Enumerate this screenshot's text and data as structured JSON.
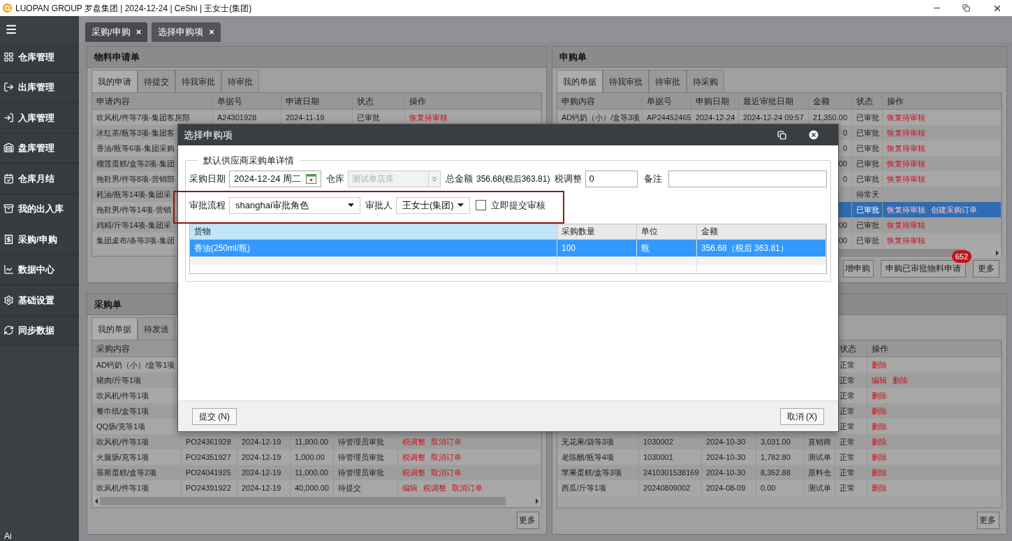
{
  "window": {
    "title": "LUOPAN GROUP 罗盘集团 | 2024-12-24 | CeShi | 王女士(集团)"
  },
  "sidebar": {
    "items": [
      {
        "label": "仓库管理"
      },
      {
        "label": "出库管理"
      },
      {
        "label": "入库管理"
      },
      {
        "label": "盘库管理"
      },
      {
        "label": "仓库月结"
      },
      {
        "label": "我的出入库"
      },
      {
        "label": "采购/申购"
      },
      {
        "label": "数据中心"
      },
      {
        "label": "基础设置"
      },
      {
        "label": "同步数据"
      }
    ],
    "footer": "Ai"
  },
  "tabs": [
    {
      "label": "采购/申购",
      "close": "×",
      "selected": false
    },
    {
      "label": "选择申购项",
      "close": "×",
      "selected": true
    }
  ],
  "panels": [
    {
      "title": "物料申请单",
      "tabs": [
        {
          "label": "我的申请",
          "selected": true
        },
        {
          "label": "待提交",
          "selected": false
        },
        {
          "label": "待我审批",
          "selected": false
        },
        {
          "label": "待审批",
          "selected": false
        }
      ],
      "table": {
        "columns": {
          "content": "申请内容",
          "number": "单据号",
          "date": "申请日期",
          "status": "状态",
          "actions": "操作"
        },
        "rows": [
          {
            "content": "吹风机/件等7项-集团客房部",
            "number": "A24301928",
            "date": "2024-11-19",
            "status": "已审批",
            "actions": [
              "恢复待审核"
            ],
            "selected": false
          },
          {
            "content": "冰红茶/瓶等3项-集团客",
            "selected": false
          },
          {
            "content": "香油/瓶等6项-集团采购",
            "selected": false
          },
          {
            "content": "榴莲蛋糕/盒等2项-集团",
            "selected": false
          },
          {
            "content": "拖鞋男/件等8项-营销部",
            "selected": false
          },
          {
            "content": "耗油/瓶等14项-集团采",
            "selected": false
          },
          {
            "content": "拖鞋男/件等14项-营销",
            "selected": false
          },
          {
            "content": "鸡精/斤等14项-集团采",
            "selected": false
          },
          {
            "content": "集团桌布/条等3项-集团",
            "selected": false
          }
        ]
      }
    },
    {
      "title": "申购单",
      "tabs": [
        {
          "label": "我的单据",
          "selected": true
        },
        {
          "label": "待我审批",
          "selected": false
        },
        {
          "label": "待审批",
          "selected": false
        },
        {
          "label": "待采购",
          "selected": false
        }
      ],
      "table": {
        "columns": {
          "content": "申购内容",
          "number": "单据号",
          "date": "申购日期",
          "approved_date": "最近审批日期",
          "amount": "金额",
          "status": "状态",
          "actions": "操作"
        },
        "rows": [
          {
            "content": "AD钙奶（小）/盒等3项",
            "number": "AP24452465",
            "date": "2024-12-24",
            "approved_date": "2024-12-24 09:57",
            "amount": "21,350.00",
            "status": "已审批",
            "actions": [
              "恢复待审核"
            ],
            "selected": false
          },
          {
            "amount": "0",
            "status": "已审批",
            "actions": [
              "恢复待审核"
            ],
            "selected": false
          },
          {
            "amount": "0",
            "status": "已审批",
            "actions": [
              "恢复待审核"
            ],
            "selected": false
          },
          {
            "amount": "00",
            "status": "已审批",
            "actions": [
              "恢复待审核"
            ],
            "selected": false
          },
          {
            "amount": "0",
            "status": "已审批",
            "actions": [
              "恢复待审核"
            ],
            "selected": false
          },
          {
            "status": "待常天",
            "selected": false
          },
          {
            "status": "已审批",
            "actions": [
              "恢复待审核",
              "创建采购订单"
            ],
            "selected": true
          },
          {
            "amount": "00",
            "status": "已审批",
            "actions": [
              "恢复待审核"
            ],
            "selected": false
          },
          {
            "amount": "00",
            "status": "已审批",
            "actions": [
              "恢复待审核"
            ],
            "selected": false
          }
        ]
      },
      "buttons": [
        {
          "label": "增申购"
        },
        {
          "label": "申购已审批物料申请",
          "badge": "652"
        },
        {
          "label": "更多"
        }
      ]
    },
    {
      "title": "采购单",
      "tabs": [
        {
          "label": "我的单据",
          "selected": true
        },
        {
          "label": "待发送",
          "selected": false
        }
      ],
      "table": {
        "columns": {
          "content": "采购内容"
        },
        "rows": [
          {
            "content": "AD钙奶（小）/盒等1项",
            "selected": false
          },
          {
            "content": "猪肉/斤等1项",
            "selected": false
          },
          {
            "content": "吹风机/件等1项",
            "selected": false
          },
          {
            "content": "餐巾纸/盒等1项",
            "selected": false
          },
          {
            "content": "QQ肠/克等1项",
            "selected": false
          },
          {
            "content": "吹风机/件等1项",
            "column_2": "PO24361928",
            "column_3": "2024-12-19",
            "column_4": "11,800.00",
            "column_5": "待管理员审批",
            "column_6": [
              "税调整",
              "取消订单"
            ],
            "selected": false
          },
          {
            "content": "火腿肠/克等1项",
            "column_2": "PO24351927",
            "column_3": "2024-12-19",
            "column_4": "1,000.00",
            "column_5": "待管理员审批",
            "column_6": [
              "税调整",
              "取消订单"
            ],
            "selected": false
          },
          {
            "content": "慕斯蛋糕/盒等2项",
            "column_2": "PO24041925",
            "column_3": "2024-12-19",
            "column_4": "11,000.00",
            "column_5": "待管理员审批",
            "column_6": [
              "税调整",
              "取消订单"
            ],
            "selected": false
          },
          {
            "content": "吹风机/件等1项",
            "column_2": "PO24391922",
            "column_3": "2024-12-19",
            "column_4": "40,000.00",
            "column_5": "待提交",
            "column_6": [
              "编辑",
              "税调整",
              "取消订单"
            ],
            "selected": false
          }
        ]
      },
      "buttons": [
        {
          "label": "更多"
        }
      ]
    },
    {
      "table": {
        "columns": {
          "status": "状态",
          "actions": "操作"
        },
        "rows": [
          {
            "status": "正常",
            "actions": [
              "删除"
            ],
            "selected": false
          },
          {
            "status": "正常",
            "actions": [
              "编辑",
              "删除"
            ],
            "selected": false
          },
          {
            "status": "正常",
            "actions": [
              "删除"
            ],
            "selected": false
          },
          {
            "status": "正常",
            "actions": [
              "删除"
            ],
            "selected": false
          },
          {
            "status": "正常",
            "actions": [
              "删除"
            ],
            "selected": false
          },
          {
            "column_1": "无花果/袋等3项",
            "column_2": "1030002",
            "column_3": "2024-10-30",
            "column_4": "3,031.00",
            "column_5": "直销商",
            "status": "正常",
            "actions": [
              "删除"
            ],
            "selected": false
          },
          {
            "column_1": "老陈醋/瓶等4项",
            "column_2": "1030001",
            "column_3": "2024-10-30",
            "column_4": "1,782.80",
            "column_5": "测试单",
            "status": "正常",
            "actions": [
              "删除"
            ],
            "selected": false
          },
          {
            "column_1": "苹果蛋糕/盒等3项",
            "column_2": "2410301538169",
            "column_3": "2024-10-30",
            "column_4": "8,352.88",
            "column_5": "原料仓",
            "status": "正常",
            "actions": [
              "删除"
            ],
            "selected": false
          },
          {
            "column_1": "西瓜/斤等1项",
            "column_2": "20240809002",
            "column_3": "2024-08-09",
            "column_4": "0.00",
            "column_5": "测试单",
            "status": "正常",
            "actions": [
              "删除"
            ],
            "selected": false
          }
        ]
      },
      "buttons": [
        {
          "label": "更多"
        }
      ]
    }
  ],
  "dialog": {
    "title": "选择申购项",
    "section_title": "默认供应商采购单详情",
    "purchase_date": {
      "label": "采购日期",
      "value": "2024-12-24 周二"
    },
    "warehouse": {
      "label": "仓库",
      "value": "测试单店库",
      "disabled": true
    },
    "total": {
      "label": "总金额",
      "value": "356.68(税后363.81)"
    },
    "tax_adjust": {
      "label": "税调整",
      "value": "0"
    },
    "remark": {
      "label": "备注"
    },
    "approval_flow": {
      "label": "审批流程",
      "value": "shanghai审批角色"
    },
    "approver": {
      "label": "审批人",
      "value": "王女士(集团)"
    },
    "submit_now": {
      "label": "立即提交审核",
      "checked": false
    },
    "grid": {
      "columns": [
        {
          "label": "货物",
          "selected": true
        },
        {
          "label": "采购数量",
          "selected": false
        },
        {
          "label": "单位",
          "selected": false
        },
        {
          "label": "金额",
          "selected": false
        }
      ],
      "rows": [
        {
          "cells": [
            "香油(250ml/瓶)",
            "100",
            "瓶",
            "356.68（税后 363.81）"
          ],
          "selected": true
        }
      ]
    },
    "buttons": [
      {
        "label": "提交 (N)"
      },
      {
        "label": "取消 (X)"
      }
    ]
  }
}
